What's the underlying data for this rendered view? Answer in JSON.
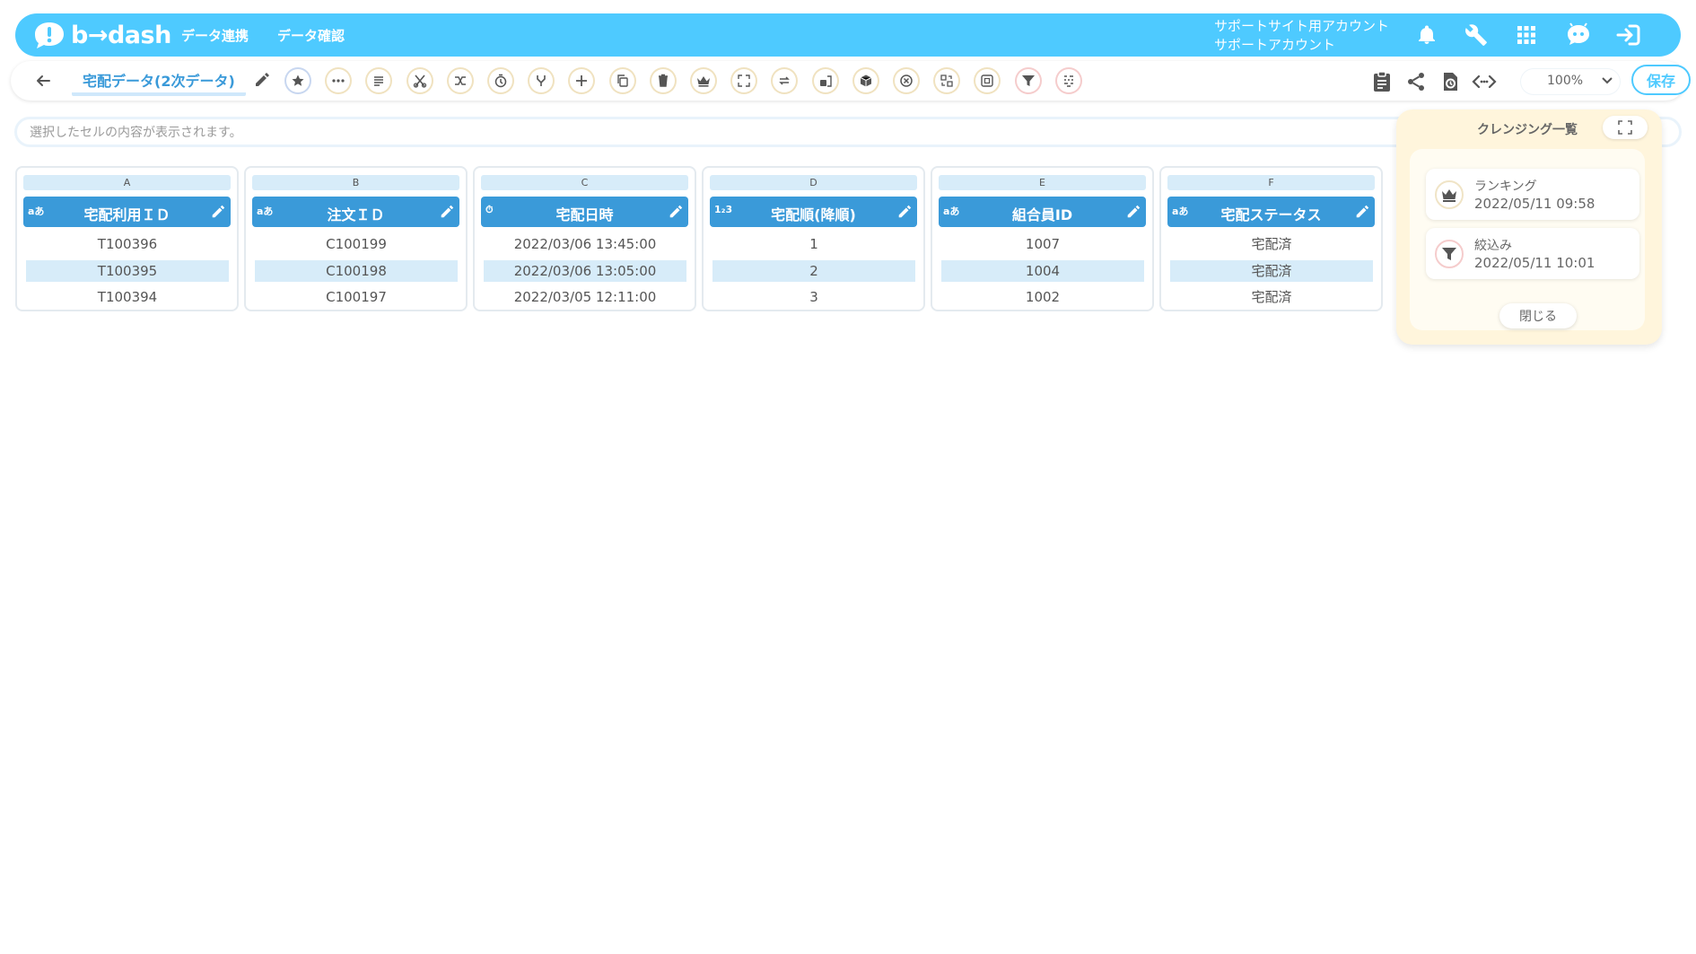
{
  "header": {
    "logo_text": "b→dash",
    "nav": [
      "データ連携",
      "データ確認"
    ],
    "account_line1": "サポートサイト用アカウント",
    "account_line2": "サポートアカウント",
    "brand_color": "#4ecaff",
    "icons": [
      "bell-icon",
      "wrench-icon",
      "grid-apps-icon",
      "chat-bot-icon",
      "logout-icon"
    ]
  },
  "toolbar": {
    "title": "宅配データ(2次データ)",
    "tools": [
      "favorite",
      "ellipsis",
      "format",
      "cut",
      "shuffle",
      "timer",
      "merge",
      "add",
      "copy",
      "delete",
      "ranking",
      "expand",
      "convert",
      "lock-split",
      "package",
      "remove",
      "replace",
      "frame",
      "filter",
      "pattern"
    ],
    "zoom": "100%",
    "save_label": "保存"
  },
  "cell_bar": {
    "placeholder": "選択したセルの内容が表示されます。"
  },
  "columns": [
    {
      "letter": "A",
      "type": "aあ",
      "name": "宅配利用ＩＤ",
      "values": [
        "T100396",
        "T100395",
        "T100394"
      ]
    },
    {
      "letter": "B",
      "type": "aあ",
      "name": "注文ＩＤ",
      "values": [
        "C100199",
        "C100198",
        "C100197"
      ]
    },
    {
      "letter": "C",
      "type": "⏱",
      "name": "宅配日時",
      "values": [
        "2022/03/06 13:45:00",
        "2022/03/06 13:05:00",
        "2022/03/05 12:11:00"
      ]
    },
    {
      "letter": "D",
      "type": "1₂3",
      "name": "宅配順(降順)",
      "values": [
        "1",
        "2",
        "3"
      ]
    },
    {
      "letter": "E",
      "type": "aあ",
      "name": "組合員ID",
      "values": [
        "1007",
        "1004",
        "1002"
      ]
    },
    {
      "letter": "F",
      "type": "aあ",
      "name": "宅配ステータス",
      "values": [
        "宅配済",
        "宅配済",
        "宅配済"
      ]
    }
  ],
  "panel": {
    "title": "クレンジング一覧",
    "items": [
      {
        "label": "ランキング",
        "time": "2022/05/11 09:58",
        "icon": "crown-icon"
      },
      {
        "label": "絞込み",
        "time": "2022/05/11 10:01",
        "icon": "filter-icon"
      }
    ],
    "close_label": "閉じる"
  }
}
